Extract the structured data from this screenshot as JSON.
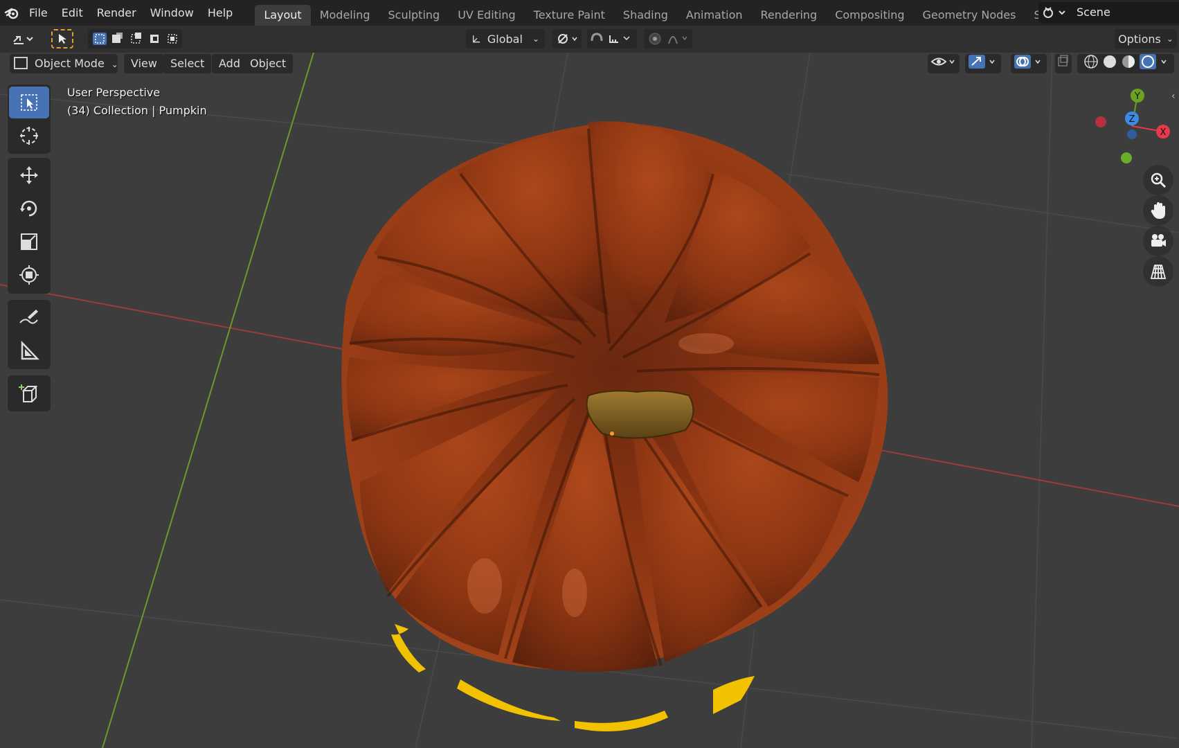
{
  "menu": {
    "items": [
      {
        "label": "File"
      },
      {
        "label": "Edit"
      },
      {
        "label": "Render"
      },
      {
        "label": "Window"
      },
      {
        "label": "Help"
      }
    ]
  },
  "workspaces": {
    "tabs": [
      {
        "label": "Layout",
        "active": true
      },
      {
        "label": "Modeling"
      },
      {
        "label": "Sculpting"
      },
      {
        "label": "UV Editing"
      },
      {
        "label": "Texture Paint"
      },
      {
        "label": "Shading"
      },
      {
        "label": "Animation"
      },
      {
        "label": "Rendering"
      },
      {
        "label": "Compositing"
      },
      {
        "label": "Geometry Nodes"
      },
      {
        "label": "Scripting"
      }
    ]
  },
  "scene": {
    "name": "Scene"
  },
  "tool_header": {
    "transform_orientation": "Global",
    "options_label": "Options"
  },
  "viewport_header": {
    "mode": "Object Mode",
    "view": "View",
    "select": "Select",
    "add": "Add",
    "object": "Object"
  },
  "viewport": {
    "perspective_label": "User Perspective",
    "collection_label": "(34) Collection | Pumpkin"
  },
  "gizmo": {
    "x_label": "X",
    "y_label": "Y",
    "z_label": "Z",
    "x_color": "#e63a4c",
    "y_color": "#6da121",
    "z_color": "#3a8ae6"
  },
  "colors": {
    "accent": "#4772b3",
    "topbar": "#232323",
    "viewport_bg": "#3d3d3d",
    "x_axis": "#9c3b3b",
    "y_axis": "#6a9a2a",
    "pumpkin": "#8a3412"
  },
  "icons": {
    "tools": [
      "select-box-icon",
      "cursor-icon",
      "move-icon",
      "rotate-icon",
      "scale-icon",
      "transform-icon",
      "annotate-icon",
      "measure-icon",
      "add-cube-icon"
    ],
    "nav": [
      "zoom-icon",
      "pan-hand-icon",
      "camera-icon",
      "grid-view-icon"
    ]
  }
}
